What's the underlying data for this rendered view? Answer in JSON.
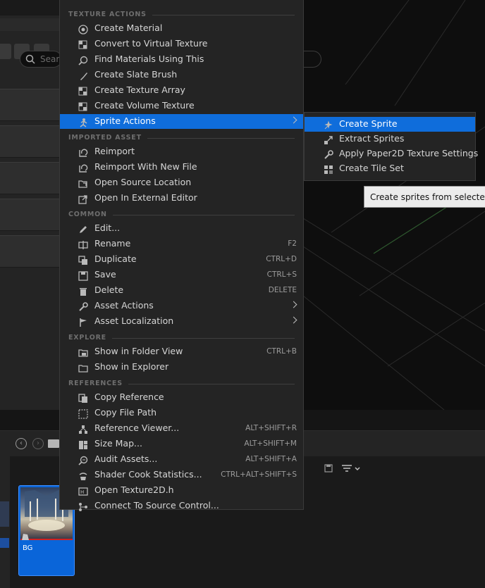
{
  "menu": {
    "sections": [
      {
        "header": "TEXTURE ACTIONS",
        "items": [
          {
            "label": "Create Material",
            "icon": "material-icon"
          },
          {
            "label": "Convert to Virtual Texture",
            "icon": "checker-icon"
          },
          {
            "label": "Find Materials Using This",
            "icon": "magnifier-icon"
          },
          {
            "label": "Create Slate Brush",
            "icon": "brush-icon"
          },
          {
            "label": "Create Texture Array",
            "icon": "checker-icon"
          },
          {
            "label": "Create Volume Texture",
            "icon": "checker-icon"
          },
          {
            "label": "Sprite Actions",
            "icon": "sprite-icon",
            "submenu": true,
            "highlighted": true
          }
        ]
      },
      {
        "header": "IMPORTED ASSET",
        "items": [
          {
            "label": "Reimport",
            "icon": "reimport-icon"
          },
          {
            "label": "Reimport With New File",
            "icon": "reimport-icon"
          },
          {
            "label": "Open Source Location",
            "icon": "folder-open-icon"
          },
          {
            "label": "Open In External Editor",
            "icon": "external-icon"
          }
        ]
      },
      {
        "header": "COMMON",
        "items": [
          {
            "label": "Edit...",
            "icon": "pencil-icon"
          },
          {
            "label": "Rename",
            "icon": "rename-icon",
            "shortcut": "F2"
          },
          {
            "label": "Duplicate",
            "icon": "duplicate-icon",
            "shortcut": "CTRL+D"
          },
          {
            "label": "Save",
            "icon": "save-icon",
            "shortcut": "CTRL+S"
          },
          {
            "label": "Delete",
            "icon": "trash-icon",
            "shortcut": "DELETE"
          },
          {
            "label": "Asset Actions",
            "icon": "wrench-icon",
            "submenu": true
          },
          {
            "label": "Asset Localization",
            "icon": "flag-icon",
            "submenu": true
          }
        ]
      },
      {
        "header": "EXPLORE",
        "items": [
          {
            "label": "Show in Folder View",
            "icon": "folder-view-icon",
            "shortcut": "CTRL+B"
          },
          {
            "label": "Show in Explorer",
            "icon": "explorer-icon"
          }
        ]
      },
      {
        "header": "REFERENCES",
        "items": [
          {
            "label": "Copy Reference",
            "icon": "copy-icon"
          },
          {
            "label": "Copy File Path",
            "icon": "copy-path-icon"
          },
          {
            "label": "Reference Viewer...",
            "icon": "reference-viewer-icon",
            "shortcut": "ALT+SHIFT+R"
          },
          {
            "label": "Size Map...",
            "icon": "size-map-icon",
            "shortcut": "ALT+SHIFT+M"
          },
          {
            "label": "Audit Assets...",
            "icon": "audit-icon",
            "shortcut": "ALT+SHIFT+A"
          },
          {
            "label": "Shader Cook Statistics...",
            "icon": "shader-icon",
            "shortcut": "CTRL+ALT+SHIFT+S"
          },
          {
            "label": "Open Texture2D.h",
            "icon": "header-file-icon"
          },
          {
            "label": "Connect To Source Control...",
            "icon": "source-control-icon"
          }
        ]
      }
    ]
  },
  "submenu": {
    "items": [
      {
        "label": "Create Sprite",
        "icon": "create-sprite-icon",
        "highlighted": true
      },
      {
        "label": "Extract Sprites",
        "icon": "extract-sprites-icon"
      },
      {
        "label": "Apply Paper2D Texture Settings",
        "icon": "wrench-icon"
      },
      {
        "label": "Create Tile Set",
        "icon": "tile-set-icon"
      }
    ]
  },
  "tooltip": {
    "text": "Create sprites from selected te"
  },
  "content_browser": {
    "search_placeholder": "Sear",
    "asset": {
      "name": "BG"
    }
  },
  "colors": {
    "highlight": "#0f6ddb",
    "menu_bg": "#242424",
    "selection": "#0a65d9"
  }
}
